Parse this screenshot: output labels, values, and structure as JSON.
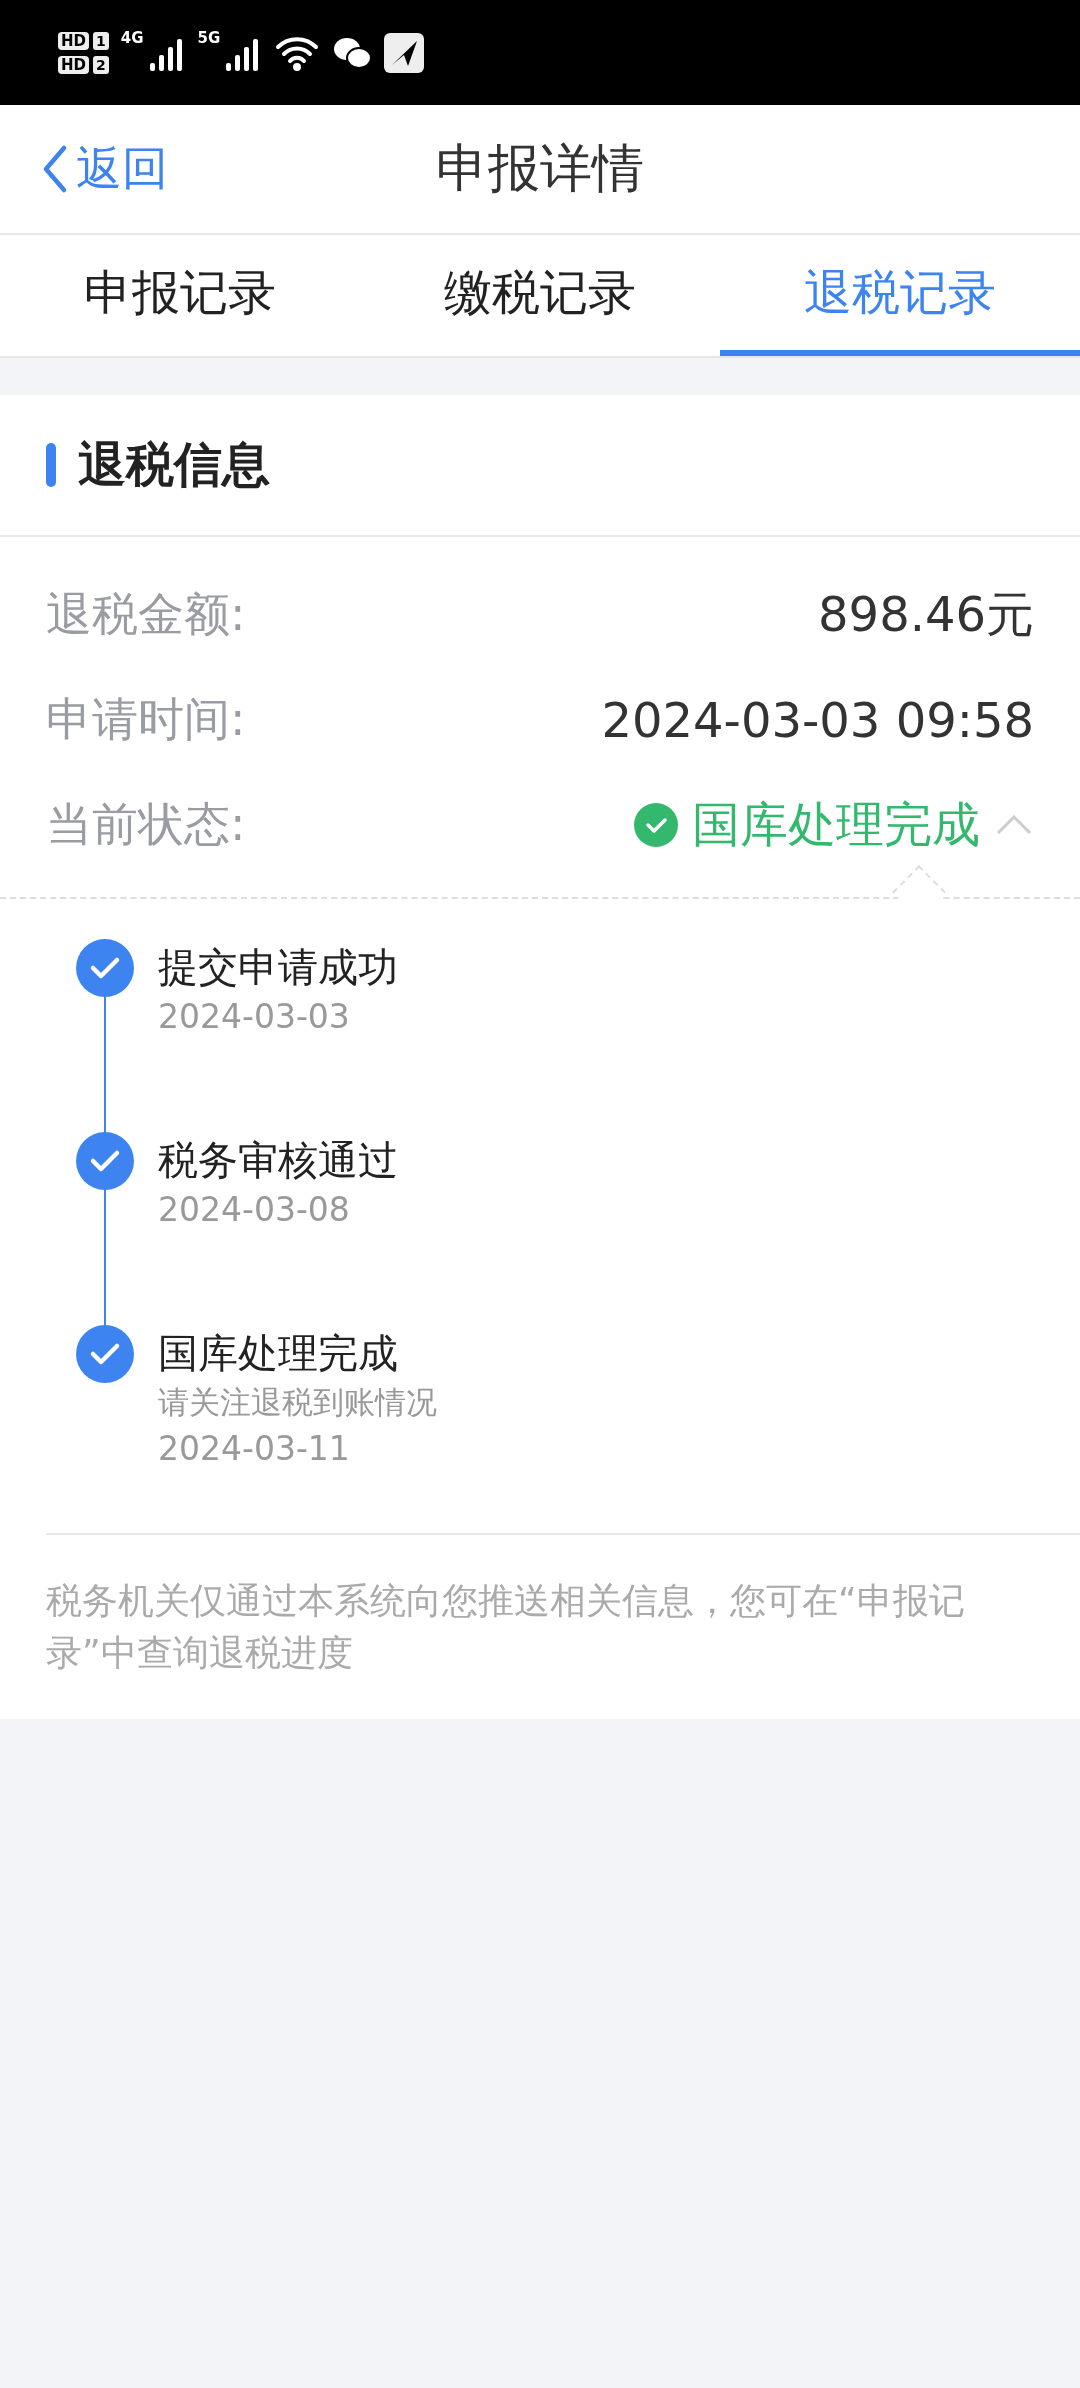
{
  "status_bar": {
    "sim_badges": [
      {
        "label": "HD",
        "slot": "1"
      },
      {
        "label": "HD",
        "slot": "2"
      }
    ],
    "networks": [
      "4G",
      "5G"
    ]
  },
  "header": {
    "back": "返回",
    "title": "申报详情"
  },
  "tabs": [
    {
      "label": "申报记录",
      "selected": false
    },
    {
      "label": "缴税记录",
      "selected": false
    },
    {
      "label": "退税记录",
      "selected": true
    }
  ],
  "section": {
    "title": "退税信息"
  },
  "fields": [
    {
      "label": "退税金额:",
      "value": "898.46元",
      "kind": "text"
    },
    {
      "label": "申请时间:",
      "value": "2024-03-03 09:58",
      "kind": "text"
    },
    {
      "label": "当前状态:",
      "value": "国库处理完成",
      "kind": "status",
      "expanded": true
    }
  ],
  "timeline": [
    {
      "title": "提交申请成功",
      "date": "2024-03-03",
      "done": true
    },
    {
      "title": "税务审核通过",
      "date": "2024-03-08",
      "done": true
    },
    {
      "title": "国库处理完成",
      "note": "请关注退税到账情况",
      "date": "2024-03-11",
      "done": true
    }
  ],
  "footer_note": "税务机关仅通过本系统向您推送相关信息，您可在“申报记录”中查询退税进度"
}
